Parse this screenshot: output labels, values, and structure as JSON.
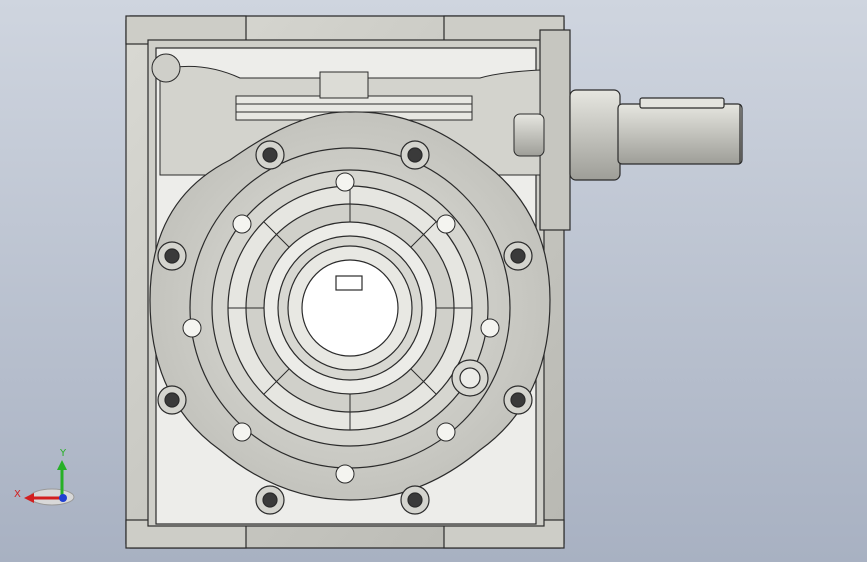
{
  "viewport": {
    "background_top": "#cfd5df",
    "background_bottom": "#a8b1c2"
  },
  "model": {
    "part_color": "#c9c9c3",
    "part_shade": "#b4b4ae",
    "edge_color": "#2b2b2b",
    "dark_cavity": "#f2f2ee"
  },
  "triad": {
    "x_label": "X",
    "y_label": "Y",
    "x_color": "#d21f1f",
    "y_color": "#27b027",
    "z_color": "#1f3fd2"
  }
}
